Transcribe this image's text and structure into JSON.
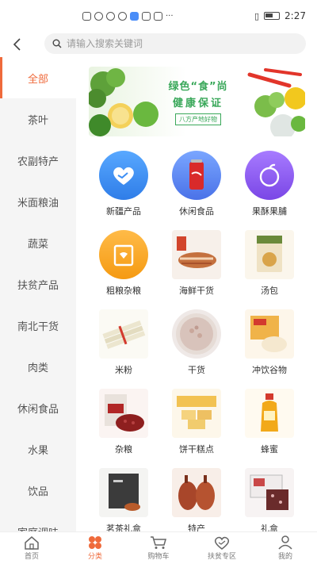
{
  "status": {
    "time": "2:27"
  },
  "search": {
    "placeholder": "请输入搜索关键词"
  },
  "sidebar": {
    "items": [
      {
        "label": "全部",
        "active": true
      },
      {
        "label": "茶叶"
      },
      {
        "label": "农副特产"
      },
      {
        "label": "米面粮油"
      },
      {
        "label": "蔬菜"
      },
      {
        "label": "扶贫产品"
      },
      {
        "label": "南北干货"
      },
      {
        "label": "肉类"
      },
      {
        "label": "休闲食品"
      },
      {
        "label": "水果"
      },
      {
        "label": "饮品"
      },
      {
        "label": "家庭调味"
      }
    ]
  },
  "banner": {
    "line1": "绿色“食”尚",
    "line2": "健康保证",
    "tag": "八方产地好物"
  },
  "categories": [
    {
      "label": "新疆产品",
      "icon": "handshake-heart-icon",
      "color": "#3d8ff5"
    },
    {
      "label": "休闲食品",
      "icon": "cola-can-icon",
      "color": "#5f8cf5"
    },
    {
      "label": "果酥果脯",
      "icon": "fruit-icon",
      "color": "#8a5cf0"
    },
    {
      "label": "粗粮杂粮",
      "icon": "grain-box-icon",
      "color": "#f5a623"
    },
    {
      "label": "海鲜干货",
      "icon": "dried-fish-icon",
      "color": "#e07a4e"
    },
    {
      "label": "汤包",
      "icon": "soup-pack-icon",
      "color": "#d8b25a"
    },
    {
      "label": "米粉",
      "icon": "rice-noodle-icon",
      "color": "#e3ddc7"
    },
    {
      "label": "干货",
      "icon": "dried-shrimp-icon",
      "color": "#d9c7c0"
    },
    {
      "label": "冲饮谷物",
      "icon": "cereal-drink-icon",
      "color": "#e9c98a"
    },
    {
      "label": "杂粮",
      "icon": "red-beans-icon",
      "color": "#9e2b2b"
    },
    {
      "label": "饼干糕点",
      "icon": "biscuit-icon",
      "color": "#f0b64a"
    },
    {
      "label": "蜂蜜",
      "icon": "honey-jar-icon",
      "color": "#f2a91a"
    },
    {
      "label": "茗茶礼盒",
      "icon": "tea-gift-icon",
      "color": "#3b3b3b"
    },
    {
      "label": "特产",
      "icon": "roast-duck-icon",
      "color": "#b0502c"
    },
    {
      "label": "礼盒",
      "icon": "gift-box-icon",
      "color": "#c94848"
    }
  ],
  "tabbar": [
    {
      "label": "首页",
      "icon": "home-icon"
    },
    {
      "label": "分类",
      "icon": "category-icon",
      "active": true
    },
    {
      "label": "购物车",
      "icon": "cart-icon"
    },
    {
      "label": "扶贫专区",
      "icon": "heart-hands-icon"
    },
    {
      "label": "我的",
      "icon": "user-icon"
    }
  ],
  "colors": {
    "accent": "#ef6a3b",
    "sidebar_bg": "#f5f5f5"
  }
}
